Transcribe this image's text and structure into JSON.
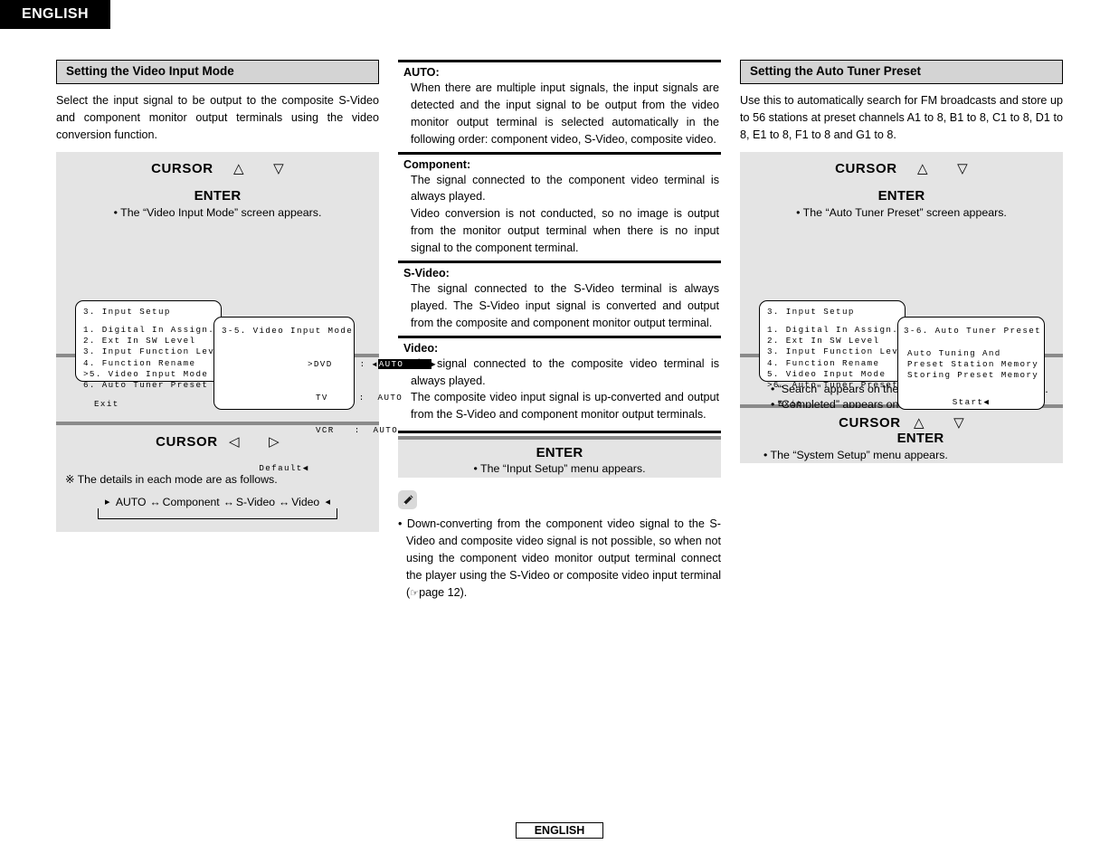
{
  "header": {
    "language_tab": "ENGLISH"
  },
  "footer": {
    "language": "ENGLISH"
  },
  "columns": {
    "col1": {
      "section_title": "Setting the Video Input Mode",
      "intro": "Select the input signal to be output to the composite S-Video and component monitor output terminals using the video conversion function.",
      "step1": {
        "cursor_label": "CURSOR",
        "up_arrow": "△",
        "down_arrow": "▽",
        "enter_label": "ENTER",
        "bullet": "• The “Video Input Mode” screen appears."
      },
      "osd_back": {
        "title": "3. Input Setup",
        "items": [
          "1. Digital In Assign.",
          "2. Ext In SW Level",
          "3. Input Function Leve",
          "4. Function Rename",
          ">5. Video Input Mode",
          "6. Auto Tuner Preset"
        ],
        "exit": "Exit"
      },
      "osd_front": {
        "title": "3-5. Video Input Mode",
        "rows": [
          {
            "label": ">DVD",
            "colon": ":",
            "value": "AUTO",
            "highlighted": true
          },
          {
            "label": "TV",
            "colon": ":",
            "value": "AUTO",
            "highlighted": false
          },
          {
            "label": "VCR",
            "colon": ":",
            "value": "AUTO",
            "highlighted": false
          }
        ],
        "footer": "Default◀"
      },
      "step2": {
        "cursor_label": "CURSOR",
        "up_arrow": "△",
        "down_arrow": "▽"
      },
      "step3": {
        "cursor_label": "CURSOR",
        "left_arrow": "◁",
        "right_arrow": "▷"
      },
      "note": "※ The details in each mode are as follows.",
      "mode_cycle": [
        "AUTO",
        "Component",
        "S-Video",
        "Video"
      ],
      "mode_cycle_arrow": "↔"
    },
    "col2": {
      "definitions": [
        {
          "term": "AUTO:",
          "paragraphs": [
            "When there are multiple input signals, the input signals are detected and the input signal to be output from the video monitor output terminal is selected automatically in the following order: component video, S-Video, composite video."
          ]
        },
        {
          "term": "Component:",
          "paragraphs": [
            "The signal connected to the component video terminal is always played.",
            "Video conversion is not conducted, so no image is output from the monitor output terminal when there is no input signal to the component terminal."
          ]
        },
        {
          "term": "S-Video:",
          "paragraphs": [
            "The signal connected to the S-Video terminal is always played. The S-Video input signal is converted and output from the composite and component monitor output terminal."
          ]
        },
        {
          "term": "Video:",
          "paragraphs": [
            "The signal connected to the composite video terminal is always played.",
            "The composite video input signal is up-converted and output from the S-Video and component monitor output terminals."
          ]
        }
      ],
      "step_enter": {
        "enter_label": "ENTER",
        "bullet": "• The “Input Setup” menu appears."
      },
      "note_icon": "pencil-icon",
      "note_text_before": "• Down-converting from the component video signal to the S-Video and composite video signal is not possible, so when not using the component video monitor output terminal connect the player using the S-Video or composite video input terminal (",
      "note_page_ref": "page 12).",
      "note_hand_icon": "☞"
    },
    "col3": {
      "section_title": "Setting the Auto Tuner Preset",
      "intro": "Use this to automatically search for FM broadcasts and store up to 56 stations at preset channels A1 to 8, B1 to 8, C1 to 8, D1 to 8, E1 to 8, F1 to 8 and G1 to 8.",
      "step1": {
        "cursor_label": "CURSOR",
        "up_arrow": "△",
        "down_arrow": "▽",
        "enter_label": "ENTER",
        "bullet": "• The “Auto Tuner Preset” screen appears."
      },
      "osd_back": {
        "title": "3. Input Setup",
        "items": [
          "1. Digital In Assign.",
          "2. Ext In SW Level",
          "3. Input Function Leve",
          "4. Function Rename",
          "5. Video Input Mode",
          ">6. Auto Tuner Preset"
        ],
        "exit": "Exit"
      },
      "osd_front": {
        "title": "3-6. Auto Tuner Preset",
        "lines": [
          "Auto Tuning And",
          "Preset Station Memory",
          "Storing Preset Memory"
        ],
        "footer": "Start◀"
      },
      "step2": {
        "cursor_label": "CURSOR",
        "left_arrow": "◁",
        "bullets": [
          "• “Search” appears on the screen and searching begins.",
          "• “Completed” appears once searching is completed."
        ]
      },
      "step3": {
        "cursor_label": "CURSOR",
        "up_arrow": "△",
        "down_arrow": "▽",
        "enter_label": "ENTER",
        "bullet": "• The “System Setup” menu appears."
      }
    }
  },
  "colors": {
    "panel_grey": "#e4e4e4",
    "heading_grey": "#d4d4d4",
    "rule_grey": "#8a8a8a",
    "black": "#000000"
  }
}
